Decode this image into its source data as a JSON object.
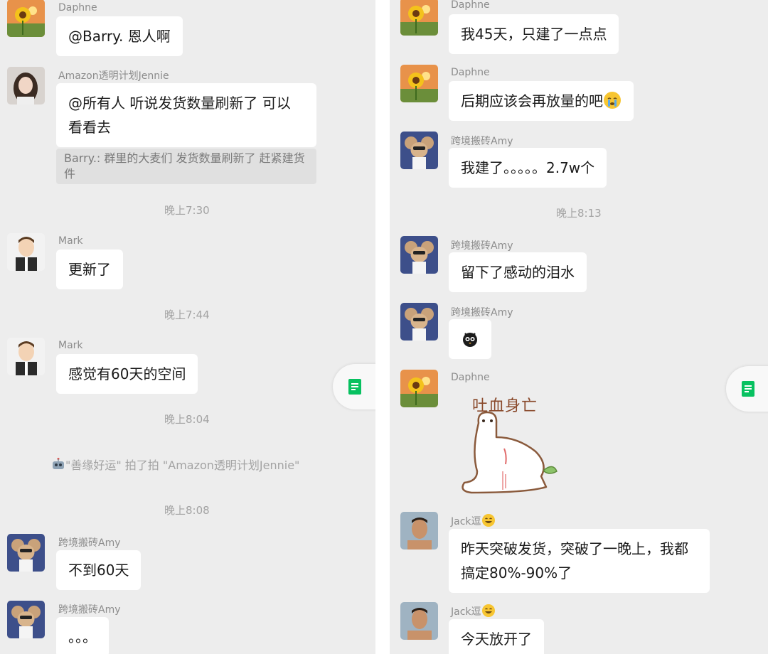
{
  "left": {
    "messages": [
      {
        "sender": "Daphne",
        "text": "@Barry. 恩人啊"
      },
      {
        "sender": "Amazon透明计划Jennie",
        "text": "@所有人 听说发货数量刷新了 可以看看去",
        "quote": "Barry.: 群里的大麦们 发货数量刷新了 赶紧建货件"
      },
      {
        "sender": "Mark",
        "text": "更新了"
      },
      {
        "sender": "Mark",
        "text": "感觉有60天的空间"
      },
      {
        "sender": "跨境搬砖Amy",
        "text": "不到60天"
      },
      {
        "sender": "跨境搬砖Amy",
        "text": "。。。"
      }
    ],
    "times": [
      "晚上7:30",
      "晚上7:44",
      "晚上8:04",
      "晚上8:08"
    ],
    "system": {
      "text": "\"善缘好运\" 拍了拍 \"Amazon透明计划Jennie\""
    }
  },
  "right": {
    "messages": [
      {
        "sender": "Daphne",
        "text": "我45天，只建了一点点"
      },
      {
        "sender": "Daphne",
        "text": "后期应该会再放量的吧"
      },
      {
        "sender": "跨境搬砖Amy",
        "text": "我建了。。。。。2.7w个"
      },
      {
        "sender": "跨境搬砖Amy",
        "text": "留下了感动的泪水"
      },
      {
        "sender": "跨境搬砖Amy",
        "text": ""
      },
      {
        "sender": "Daphne",
        "text": ""
      },
      {
        "sender": "Jack逗",
        "text": "昨天突破发货，突破了一晚上，我都搞定80%-90%了"
      },
      {
        "sender": "Jack逗",
        "text": "今天放开了"
      }
    ],
    "times": [
      "晚上8:13"
    ],
    "sticker": {
      "text": "吐血身亡"
    }
  },
  "icons": {
    "float_button": "document-icon",
    "emoji_cry": "crying-emoji-icon",
    "emoji_grin": "grinning-emoji-icon",
    "emoji_bird": "black-bird-emoji-icon",
    "robot": "robot-emoji-icon"
  },
  "colors": {
    "background": "#ededed",
    "bubble": "#ffffff",
    "quote": "#e0e0e0",
    "meta_text": "#8c8c8c",
    "accent": "#07c160"
  }
}
